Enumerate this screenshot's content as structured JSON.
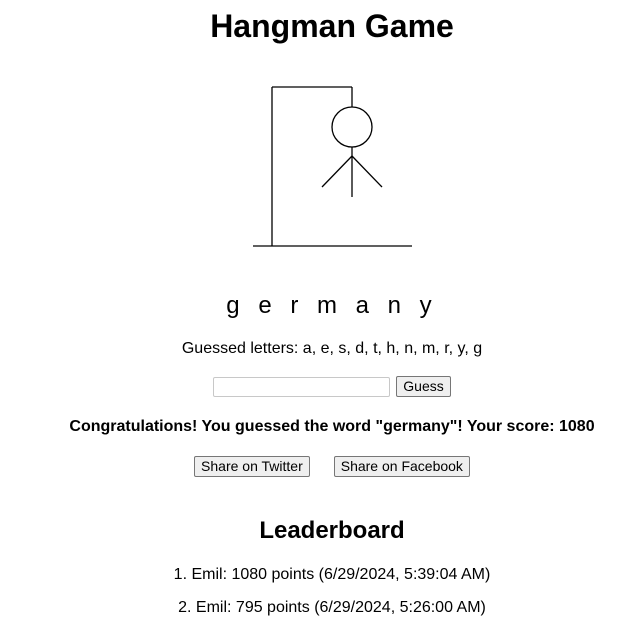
{
  "page": {
    "title": "Hangman Game"
  },
  "game": {
    "word_display": "g e r m a n y",
    "guessed_label": "Guessed letters: a, e, s, d, t, h, n, m, r, y, g",
    "input_value": "",
    "guess_button": "Guess",
    "message": "Congratulations! You guessed the word \"germany\"! Your score: 1080"
  },
  "share": {
    "twitter": "Share on Twitter",
    "facebook": "Share on Facebook"
  },
  "leaderboard": {
    "title": "Leaderboard",
    "entries": [
      "1. Emil: 1080 points (6/29/2024, 5:39:04 AM)",
      "2. Emil: 795 points (6/29/2024, 5:26:00 AM)"
    ]
  }
}
